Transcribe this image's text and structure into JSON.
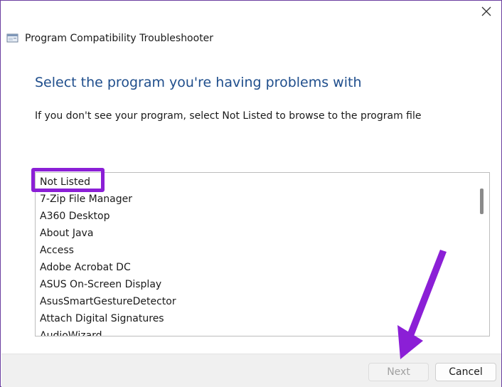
{
  "window": {
    "title": "Program Compatibility Troubleshooter"
  },
  "content": {
    "heading": "Select the program you're having problems with",
    "instruction": "If you don't see your program, select Not Listed to browse to the program file"
  },
  "program_list": {
    "items": [
      "Not Listed",
      "7-Zip File Manager",
      "A360 Desktop",
      "About Java",
      "Access",
      "Adobe Acrobat DC",
      "ASUS On-Screen Display",
      "AsusSmartGestureDetector",
      "Attach Digital Signatures",
      "AudioWizard"
    ]
  },
  "buttons": {
    "next": "Next",
    "cancel": "Cancel"
  },
  "colors": {
    "heading": "#1f4e8c",
    "annotation": "#8b1fd6",
    "window_border": "#6b3fa0"
  },
  "icons": {
    "close": "close-icon",
    "app": "troubleshooter-app-icon"
  }
}
